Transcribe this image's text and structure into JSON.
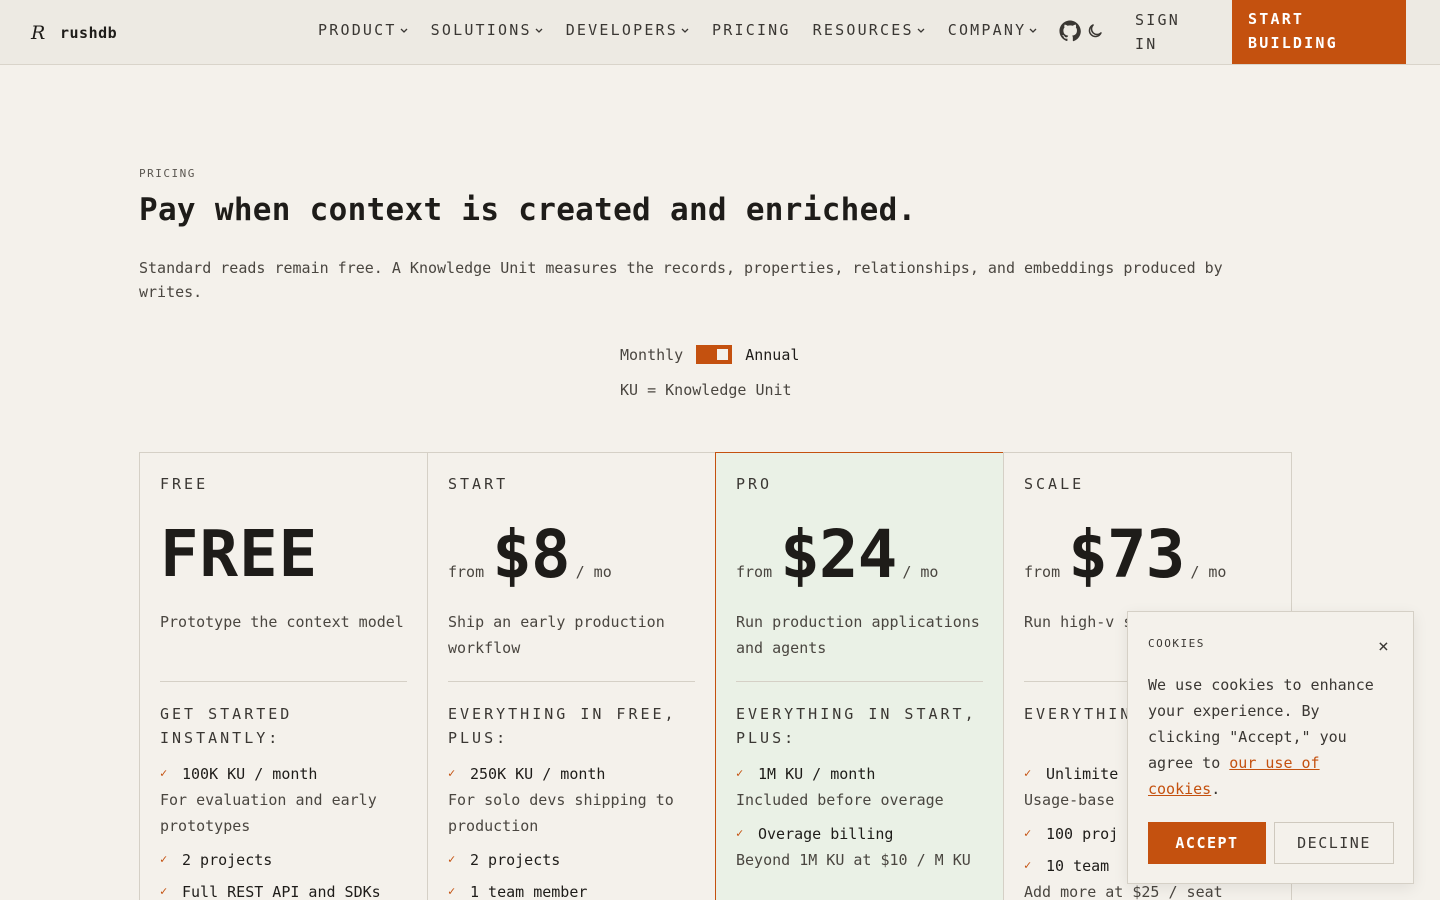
{
  "brand": {
    "name": "rushdb",
    "logo_mark": "R"
  },
  "nav": {
    "items": [
      {
        "label": "PRODUCT",
        "dropdown": true
      },
      {
        "label": "SOLUTIONS",
        "dropdown": true
      },
      {
        "label": "DEVELOPERS",
        "dropdown": true
      },
      {
        "label": "PRICING",
        "dropdown": false
      },
      {
        "label": "RESOURCES",
        "dropdown": true
      },
      {
        "label": "COMPANY",
        "dropdown": true
      }
    ],
    "icons": [
      "github-icon",
      "moon-icon"
    ],
    "sign_in": "SIGN IN",
    "cta": "START BUILDING"
  },
  "hero": {
    "eyebrow": "PRICING",
    "title": "Pay when context is created and enriched.",
    "subtitle": "Standard reads remain free. A Knowledge Unit measures the records, properties, relationships, and embeddings produced by writes."
  },
  "billing": {
    "monthly_label": "Monthly",
    "annual_label": "Annual",
    "selected": "Annual",
    "ku_note": "KU = Knowledge Unit"
  },
  "plans": [
    {
      "name": "FREE",
      "price_display": "FREE",
      "description": "Prototype the context model",
      "includes_heading": "GET STARTED INSTANTLY:",
      "features": [
        {
          "title": "100K KU / month",
          "sub": "For evaluation and early prototypes"
        },
        {
          "title": "2 projects",
          "sub": ""
        },
        {
          "title": "Full REST API and SDKs",
          "sub": ""
        }
      ]
    },
    {
      "name": "START",
      "from": "from",
      "amount": "$8",
      "per": "/ mo",
      "description": "Ship an early production workflow",
      "includes_heading": "EVERYTHING IN FREE, PLUS:",
      "features": [
        {
          "title": "250K KU / month",
          "sub": "For solo devs shipping to production"
        },
        {
          "title": "2 projects",
          "sub": ""
        },
        {
          "title": "1 team member",
          "sub": ""
        }
      ]
    },
    {
      "name": "PRO",
      "from": "from",
      "amount": "$24",
      "per": "/ mo",
      "description": "Run production applications and agents",
      "includes_heading": "EVERYTHING IN START, PLUS:",
      "features": [
        {
          "title": "1M KU / month",
          "sub": "Included before overage"
        },
        {
          "title": "Overage billing",
          "sub": "Beyond 1M KU at $10 / M KU"
        }
      ]
    },
    {
      "name": "SCALE",
      "from": "from",
      "amount": "$73",
      "per": "/ mo",
      "description": "Run high-v shared con",
      "includes_heading": "EVERYTHIN PRO, PLUS",
      "features": [
        {
          "title": "Unlimite",
          "sub": "Usage-base"
        },
        {
          "title": "100 proj",
          "sub": ""
        },
        {
          "title": "10 team",
          "sub": "Add more at $25 / seat"
        }
      ]
    }
  ],
  "cookie": {
    "title": "COOKIES",
    "close": "×",
    "text_before": "We use cookies to enhance your experience. By clicking \"Accept,\" you agree to ",
    "link": "our use of cookies",
    "text_after": ".",
    "accept": "ACCEPT",
    "decline": "DECLINE"
  },
  "colors": {
    "accent": "#c4510f",
    "background": "#f4f1eb",
    "header_bg": "#edeae3",
    "pro_card_bg": "#eaf1e6",
    "text": "#1e1c19"
  }
}
